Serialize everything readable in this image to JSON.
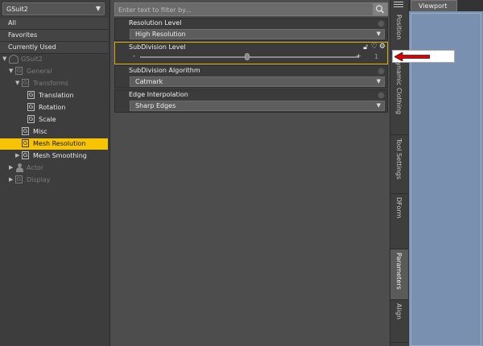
{
  "left_panel": {
    "node_select": "GSuit2",
    "filters": [
      "All",
      "Favorites",
      "Currently Used"
    ],
    "tree": [
      {
        "label": "GSuit2"
      },
      {
        "label": "General"
      },
      {
        "label": "Transforms"
      },
      {
        "label": "Translation"
      },
      {
        "label": "Rotation"
      },
      {
        "label": "Scale"
      },
      {
        "label": "Misc"
      },
      {
        "label": "Mesh Resolution"
      },
      {
        "label": "Mesh Smoothing"
      },
      {
        "label": "Actor"
      },
      {
        "label": "Display"
      }
    ]
  },
  "center_panel": {
    "filter_placeholder": "Enter text to filter by...",
    "properties": [
      {
        "title": "Resolution Level",
        "value": "High Resolution"
      },
      {
        "title": "SubDivision Level",
        "slider_fraction": 0.49,
        "value_text": "1"
      },
      {
        "title": "SubDivision Algorithm",
        "value": "Catmark"
      },
      {
        "title": "Edge Interpolation",
        "value": "Sharp Edges"
      }
    ],
    "slider_minus": "-",
    "slider_plus": "+"
  },
  "tabs": [
    "Position",
    "Dynamic Clothing",
    "Tool Settings",
    "DForm",
    "Parameters",
    "Align"
  ],
  "viewport": {
    "tab_label": "Viewport"
  },
  "colors": {
    "selection": "#f6c400",
    "highlight_border": "#d6a800",
    "viewport": "#7990b0",
    "callout_arrow": "#e00000"
  }
}
